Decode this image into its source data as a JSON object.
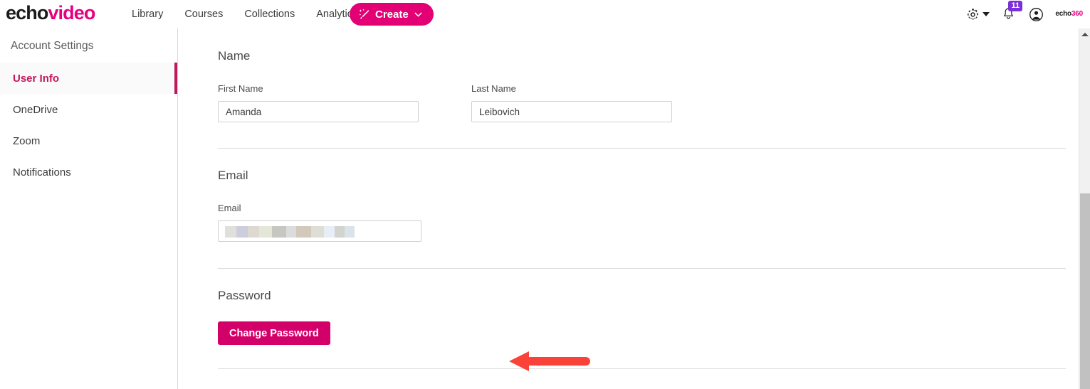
{
  "header": {
    "logo": {
      "part1": "echo",
      "part2": "video"
    },
    "nav": [
      {
        "label": "Library"
      },
      {
        "label": "Courses"
      },
      {
        "label": "Collections"
      },
      {
        "label": "Analytics"
      }
    ],
    "create_button": {
      "label": "Create",
      "icon": "magic-wand-icon",
      "chevron": "chevron-down-icon"
    },
    "settings_icon": "gear-icon",
    "notifications": {
      "icon": "bell-icon",
      "badge_count": "11",
      "badge_color": "#7b2fd6"
    },
    "account_icon": "account-circle-icon",
    "brand_mark": {
      "part1": "echo",
      "part2": "360"
    }
  },
  "sidebar": {
    "title": "Account Settings",
    "items": [
      {
        "label": "User Info",
        "active": true
      },
      {
        "label": "OneDrive",
        "active": false
      },
      {
        "label": "Zoom",
        "active": false
      },
      {
        "label": "Notifications",
        "active": false
      }
    ]
  },
  "main": {
    "name_section": {
      "title": "Name",
      "first_name": {
        "label": "First Name",
        "value": "Amanda",
        "placeholder": "First Name"
      },
      "last_name": {
        "label": "Last Name",
        "value": "Leibovich",
        "placeholder": "Last Name"
      }
    },
    "email_section": {
      "title": "Email",
      "email": {
        "label": "Email",
        "value": "",
        "placeholder": "Email",
        "redacted": true
      }
    },
    "password_section": {
      "title": "Password",
      "change_password_label": "Change Password"
    }
  },
  "annotation": {
    "arrow": {
      "direction": "left",
      "color": "#fa4238",
      "points_to": "change-password-button"
    }
  },
  "scrollbar": {
    "up_arrow_icon": "scroll-up-arrow-icon",
    "thumb": "scroll-thumb"
  },
  "colors": {
    "brand_magenta": "#e6007e",
    "create_button": "#e20074",
    "change_password_button": "#d4006a",
    "active_item": "#c2185b",
    "badge_purple": "#7b2fd6",
    "annotation_red": "#fa4238"
  }
}
